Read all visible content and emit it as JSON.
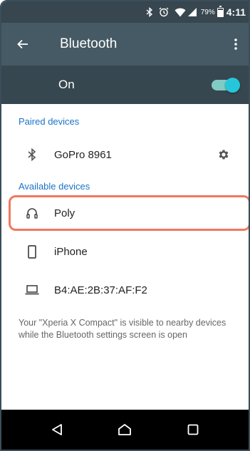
{
  "statusbar": {
    "battery_percent": "79%",
    "battery_level": 0.79,
    "time": "4:11",
    "icons": [
      "bluetooth-icon",
      "alarm-icon",
      "wifi-icon",
      "signal-icon",
      "battery-icon"
    ]
  },
  "appbar": {
    "title": "Bluetooth",
    "back_icon": "arrow-left-icon",
    "more_icon": "more-vert-icon"
  },
  "toggle": {
    "label": "On",
    "state": "on",
    "accent": "#26c6da"
  },
  "paired": {
    "header": "Paired devices",
    "devices": [
      {
        "name": "GoPro 8961",
        "icon": "bluetooth-icon",
        "trailing_icon": "gear-icon"
      }
    ]
  },
  "available": {
    "header": "Available devices",
    "devices": [
      {
        "name": "Poly",
        "icon": "headset-icon",
        "highlighted": true
      },
      {
        "name": "iPhone",
        "icon": "phone-icon"
      },
      {
        "name": "B4:AE:2B:37:AF:F2",
        "icon": "laptop-icon"
      }
    ]
  },
  "visibility_note": "Your \"Xperia X Compact\" is visible to nearby devices while the Bluetooth settings screen is open",
  "navbar": {
    "buttons": [
      "back-triangle-icon",
      "home-icon",
      "recents-icon"
    ]
  },
  "colors": {
    "statusbar": "#37464f",
    "appbar": "#455a64",
    "togglebar": "#37474f",
    "section_header": "#1a73c6",
    "highlight": "#f07860"
  }
}
